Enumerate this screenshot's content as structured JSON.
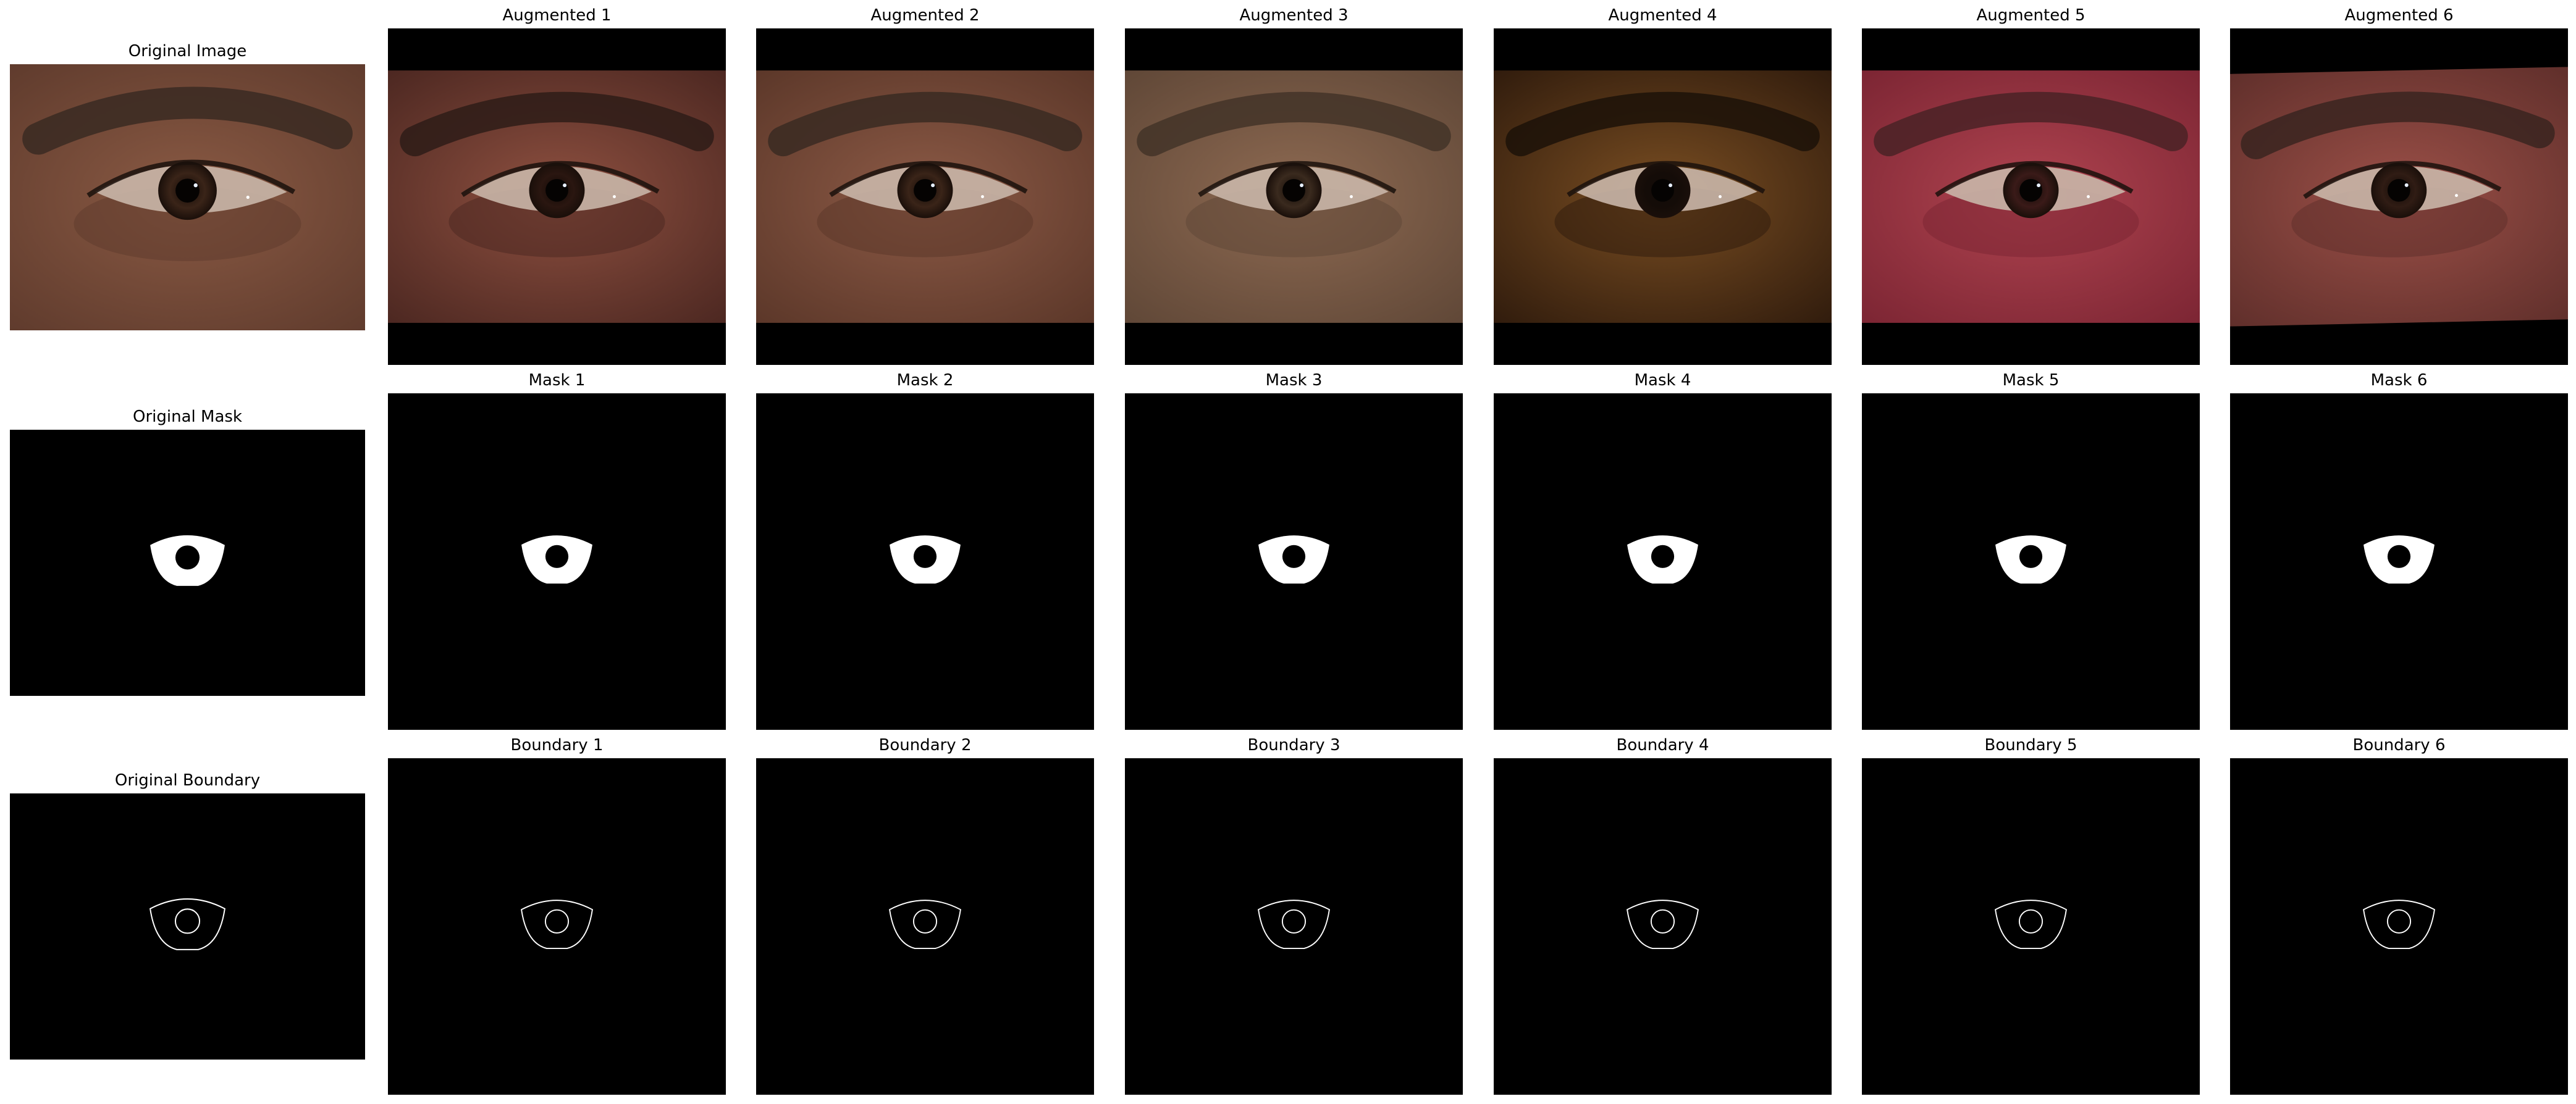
{
  "rows": [
    {
      "name": "image",
      "panels": [
        {
          "title": "Original Image",
          "kind": "photo",
          "tint": "orig"
        },
        {
          "title": "Augmented 1",
          "kind": "photo",
          "tint": "aug1",
          "scaled": true
        },
        {
          "title": "Augmented 2",
          "kind": "photo",
          "tint": "aug2",
          "scaled": true
        },
        {
          "title": "Augmented 3",
          "kind": "photo",
          "tint": "aug3",
          "scaled": true
        },
        {
          "title": "Augmented 4",
          "kind": "photo",
          "tint": "aug4",
          "scaled": true
        },
        {
          "title": "Augmented 5",
          "kind": "photo",
          "tint": "aug5",
          "scaled": true
        },
        {
          "title": "Augmented 6",
          "kind": "photo",
          "tint": "aug6",
          "scaled": true,
          "rotated": true
        }
      ]
    },
    {
      "name": "mask",
      "panels": [
        {
          "title": "Original Mask",
          "kind": "mask"
        },
        {
          "title": "Mask 1",
          "kind": "mask"
        },
        {
          "title": "Mask 2",
          "kind": "mask"
        },
        {
          "title": "Mask 3",
          "kind": "mask"
        },
        {
          "title": "Mask 4",
          "kind": "mask"
        },
        {
          "title": "Mask 5",
          "kind": "mask"
        },
        {
          "title": "Mask 6",
          "kind": "mask"
        }
      ]
    },
    {
      "name": "boundary",
      "panels": [
        {
          "title": "Original Boundary",
          "kind": "boundary"
        },
        {
          "title": "Boundary 1",
          "kind": "boundary"
        },
        {
          "title": "Boundary 2",
          "kind": "boundary"
        },
        {
          "title": "Boundary 3",
          "kind": "boundary"
        },
        {
          "title": "Boundary 4",
          "kind": "boundary"
        },
        {
          "title": "Boundary 5",
          "kind": "boundary"
        },
        {
          "title": "Boundary 6",
          "kind": "boundary"
        }
      ]
    }
  ],
  "tints": {
    "orig": {
      "skin": "#8a5a44",
      "skin_dark": "#5e3a2c",
      "brow": "#3a2a22",
      "iris": "#3a2418"
    },
    "aug1": {
      "skin": "#8e5040",
      "skin_dark": "#4a2620",
      "brow": "#2e1c18",
      "iris": "#2a1610"
    },
    "aug2": {
      "skin": "#8c5a46",
      "skin_dark": "#5a3628",
      "brow": "#3a2a22",
      "iris": "#3a2418"
    },
    "aug3": {
      "skin": "#8e6a52",
      "skin_dark": "#5e4636",
      "brow": "#433428",
      "iris": "#3a2a1e"
    },
    "aug4": {
      "skin": "#7a4e22",
      "skin_dark": "#2e1a0c",
      "brow": "#1c1208",
      "iris": "#140c08"
    },
    "aug5": {
      "skin": "#b04450",
      "skin_dark": "#7a2432",
      "brow": "#4a2226",
      "iris": "#3a1a18"
    },
    "aug6": {
      "skin": "#9c5048",
      "skin_dark": "#5e2e2a",
      "brow": "#3a2420",
      "iris": "#301c14"
    }
  }
}
